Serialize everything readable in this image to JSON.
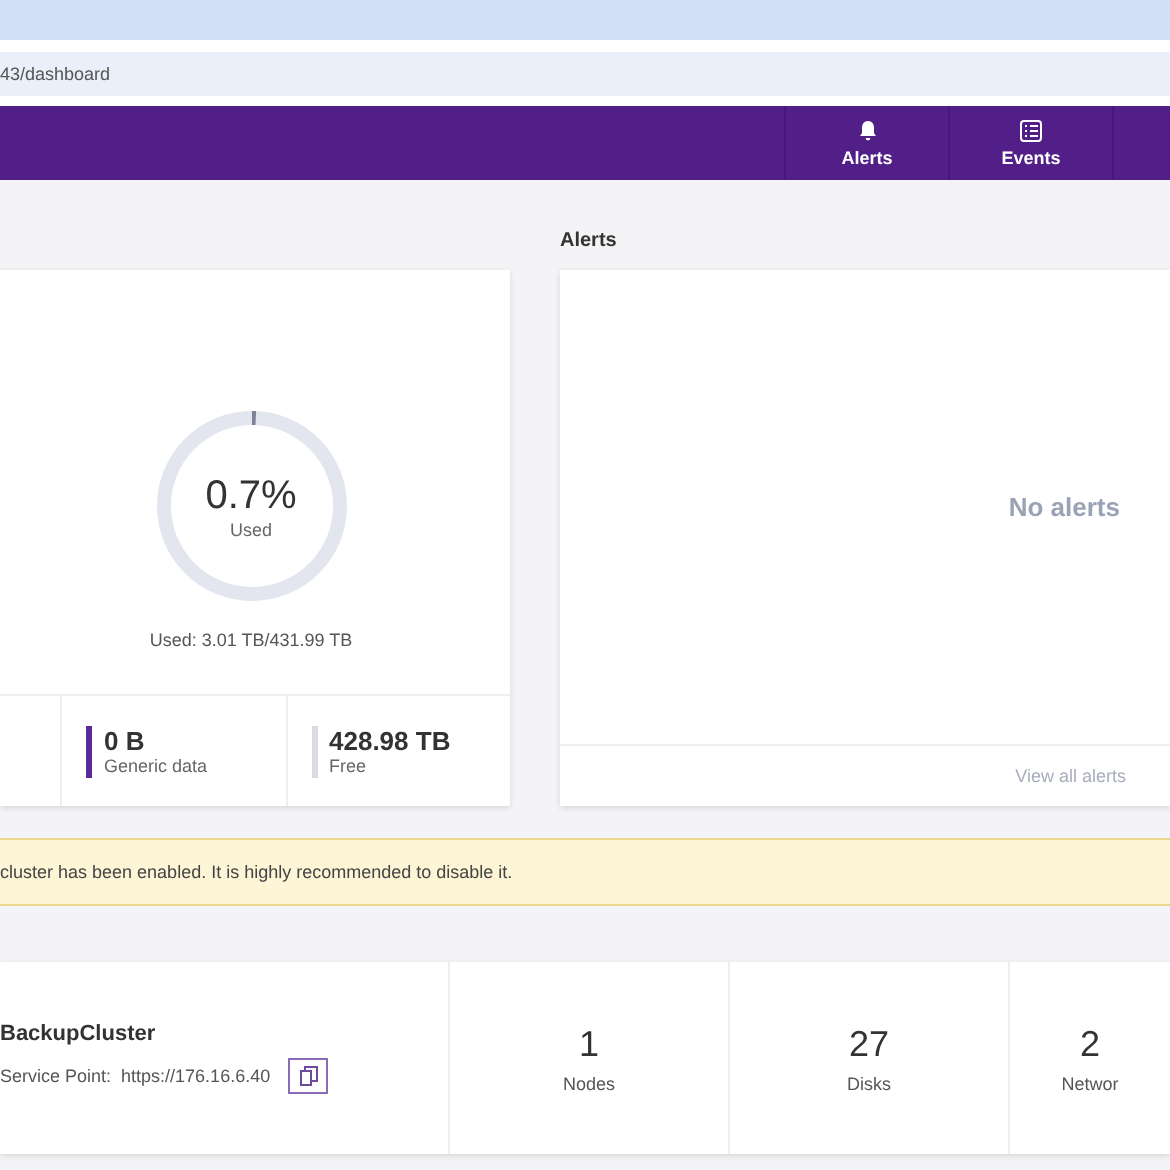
{
  "browser": {
    "address": "43/dashboard"
  },
  "nav": {
    "items": [
      {
        "label": "Alerts",
        "kind": "bell"
      },
      {
        "label": "Events",
        "kind": "list"
      }
    ]
  },
  "capacity": {
    "level": 0.007,
    "percent": "0.7%",
    "percent_label": "Used",
    "summary": "Used: 3.01 TB/431.99 TB",
    "stats": [
      {
        "value": "0 B",
        "label": "Generic data",
        "color": "#5b2a9a"
      },
      {
        "value": "428.98 TB",
        "label": "Free",
        "color": "#d8dbe6"
      }
    ]
  },
  "alerts": {
    "title": "Alerts",
    "empty_text": "No alerts",
    "link": "View all alerts"
  },
  "warning": {
    "text": "cluster has been enabled. It is highly recommended to disable it."
  },
  "cluster": {
    "name": "BackupCluster",
    "service_label": "Service Point:",
    "service_url": "https://176.16.6.40",
    "counts": [
      {
        "value": "1",
        "label": "Nodes"
      },
      {
        "value": "27",
        "label": "Disks"
      },
      {
        "value": "2",
        "label": "Networ"
      }
    ]
  }
}
